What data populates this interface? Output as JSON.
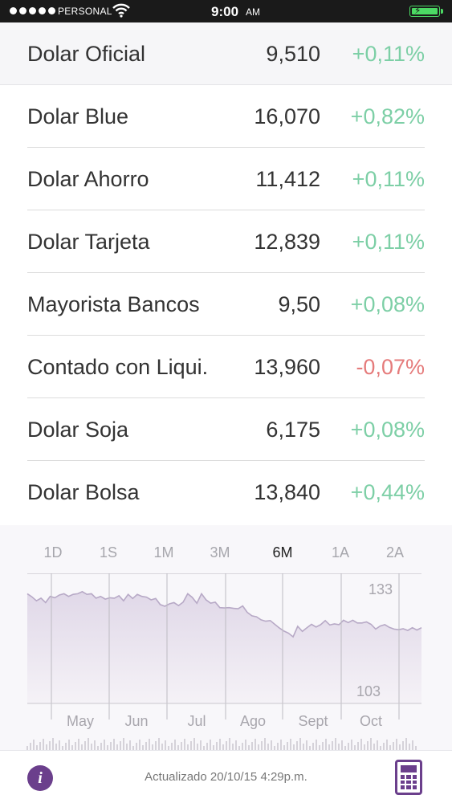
{
  "status_bar": {
    "carrier": "PERSONAL",
    "time": "9:00",
    "ampm": "AM"
  },
  "rates": [
    {
      "name": "Dolar Oficial",
      "value": "9,510",
      "change": "+0,11%",
      "direction": "up"
    },
    {
      "name": "Dolar Blue",
      "value": "16,070",
      "change": "+0,82%",
      "direction": "up"
    },
    {
      "name": "Dolar Ahorro",
      "value": "11,412",
      "change": "+0,11%",
      "direction": "up"
    },
    {
      "name": "Dolar Tarjeta",
      "value": "12,839",
      "change": "+0,11%",
      "direction": "up"
    },
    {
      "name": "Mayorista Bancos",
      "value": "9,50",
      "change": "+0,08%",
      "direction": "up"
    },
    {
      "name": "Contado con Liqui.",
      "value": "13,960",
      "change": "-0,07%",
      "direction": "down"
    },
    {
      "name": "Dolar Soja",
      "value": "6,175",
      "change": "+0,08%",
      "direction": "up"
    },
    {
      "name": "Dolar Bolsa",
      "value": "13,840",
      "change": "+0,44%",
      "direction": "up"
    }
  ],
  "range_tabs": [
    "1D",
    "1S",
    "1M",
    "3M",
    "6M",
    "1A",
    "2A"
  ],
  "active_range": "6M",
  "chart_data": {
    "type": "area",
    "x": [
      "May",
      "Jun",
      "Jul",
      "Ago",
      "Sept",
      "Oct"
    ],
    "yticks": [
      "133",
      "103"
    ],
    "ylim": [
      103,
      133
    ],
    "values": [
      131.5,
      130.6,
      129.4,
      130.2,
      128.9,
      130.7,
      130.3,
      131.1,
      131.5,
      130.7,
      131.3,
      131.5,
      132.1,
      131.3,
      131.5,
      130.2,
      130.7,
      129.9,
      130.3,
      130.2,
      130.9,
      129.4,
      131.3,
      130.1,
      131.3,
      130.7,
      130.5,
      129.7,
      130.1,
      128.3,
      127.8,
      128.5,
      128.9,
      128.0,
      129.0,
      131.5,
      130.4,
      128.7,
      131.5,
      129.7,
      128.7,
      129.0,
      127.4,
      127.3,
      127.4,
      127.2,
      127.1,
      127.9,
      126.0,
      125.0,
      124.7,
      123.8,
      123.4,
      123.6,
      122.5,
      121.4,
      120.5,
      119.9,
      118.8,
      121.9,
      120.4,
      121.5,
      122.5,
      121.7,
      122.4,
      123.6,
      122.3,
      122.6,
      122.4,
      123.7,
      123.0,
      123.7,
      122.9,
      122.9,
      123.2,
      122.5,
      121.1,
      122.0,
      122.4,
      121.6,
      121.1,
      120.9,
      121.2,
      120.7,
      121.5,
      120.8,
      121.5
    ],
    "grid": true,
    "color": "#7a3f9b"
  },
  "footer": {
    "updated": "Actualizado 20/10/15  4:29p.m."
  },
  "icons": [
    "wifi-icon",
    "battery-icon",
    "info-icon",
    "calculator-icon"
  ]
}
